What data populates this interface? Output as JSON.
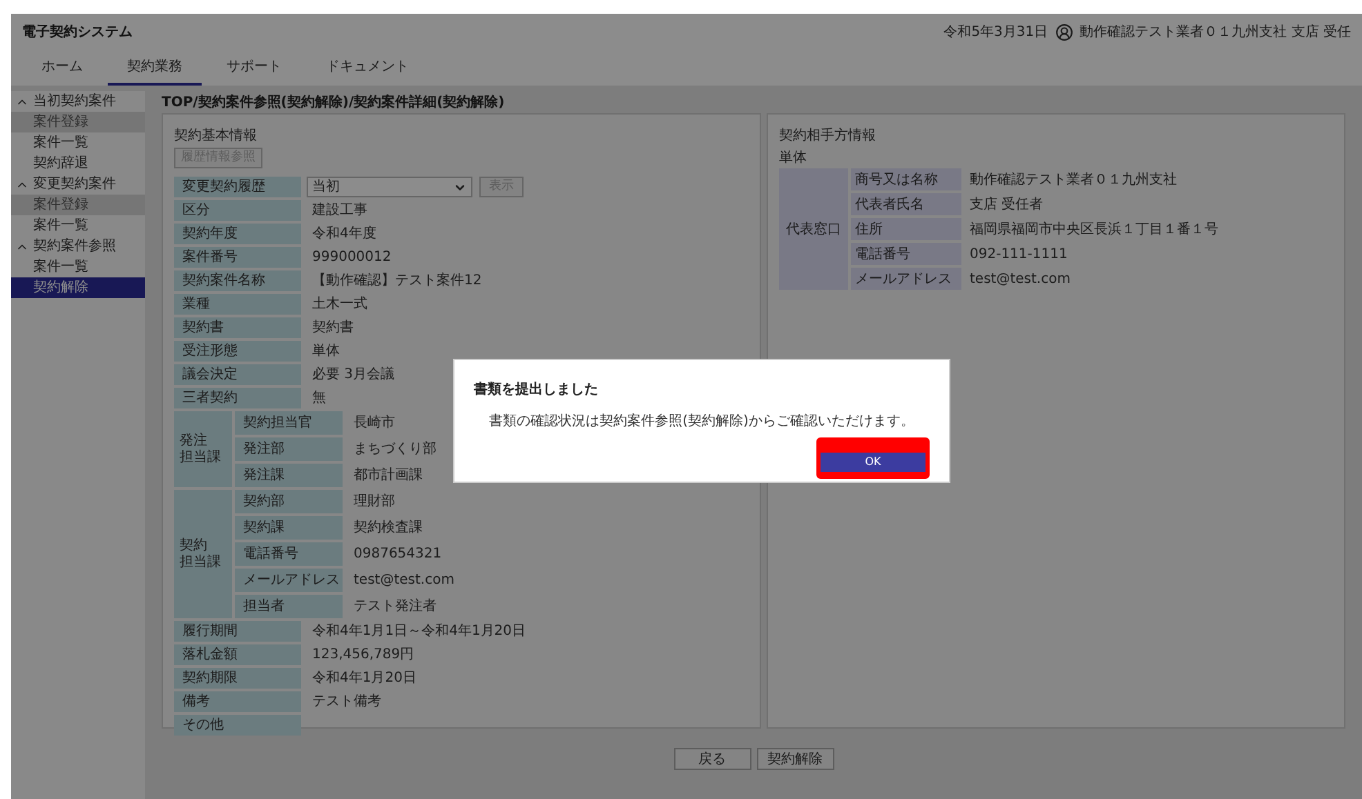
{
  "app": {
    "title": "電子契約システム",
    "date": "令和5年3月31日",
    "user": "動作確認テスト業者０１九州支社 支店 受任"
  },
  "tabs": [
    {
      "label": "ホーム",
      "selected": false
    },
    {
      "label": "契約業務",
      "selected": true
    },
    {
      "label": "サポート",
      "selected": false
    },
    {
      "label": "ドキュメント",
      "selected": false
    }
  ],
  "sidebar": [
    {
      "label": "当初契約案件",
      "expanded": true,
      "children": [
        {
          "label": "案件登録",
          "disabled": true,
          "selected": false
        },
        {
          "label": "案件一覧",
          "disabled": false,
          "selected": false
        },
        {
          "label": "契約辞退",
          "disabled": false,
          "selected": false
        }
      ]
    },
    {
      "label": "変更契約案件",
      "expanded": true,
      "children": [
        {
          "label": "案件登録",
          "disabled": true,
          "selected": false
        },
        {
          "label": "案件一覧",
          "disabled": false,
          "selected": false
        }
      ]
    },
    {
      "label": "契約案件参照",
      "expanded": true,
      "children": [
        {
          "label": "案件一覧",
          "disabled": false,
          "selected": false
        },
        {
          "label": "契約解除",
          "disabled": false,
          "selected": true
        }
      ]
    }
  ],
  "breadcrumb": "TOP/契約案件参照(契約解除)/契約案件詳細(契約解除)",
  "contract": {
    "title": "契約基本情報",
    "history_button": {
      "label": "履歴情報参照",
      "disabled": true
    },
    "rows": [
      {
        "kind": "select",
        "label": "変更契約履歴",
        "value": "当初",
        "button": "表示",
        "button_disabled": true
      },
      {
        "kind": "field",
        "label": "区分",
        "value": "建設工事"
      },
      {
        "kind": "field",
        "label": "契約年度",
        "value": "令和4年度"
      },
      {
        "kind": "field",
        "label": "案件番号",
        "value": "999000012"
      },
      {
        "kind": "field",
        "label": "契約案件名称",
        "value": "【動作確認】テスト案件12"
      },
      {
        "kind": "field",
        "label": "業種",
        "value": "土木一式"
      },
      {
        "kind": "field",
        "label": "契約書",
        "value": "契約書"
      },
      {
        "kind": "field",
        "label": "受注形態",
        "value": "単体"
      },
      {
        "kind": "field",
        "label": "議会決定",
        "value": "必要 3月会議"
      },
      {
        "kind": "field",
        "label": "三者契約",
        "value": "無"
      },
      {
        "kind": "group",
        "label_lines": [
          "発注",
          "担当課"
        ],
        "items": [
          {
            "label": "契約担当官",
            "value": "長崎市"
          },
          {
            "label": "発注部",
            "value": "まちづくり部"
          },
          {
            "label": "発注課",
            "value": "都市計画課"
          }
        ]
      },
      {
        "kind": "group",
        "label_lines": [
          "契約",
          "担当課"
        ],
        "items": [
          {
            "label": "契約部",
            "value": "理財部"
          },
          {
            "label": "契約課",
            "value": "契約検査課"
          },
          {
            "label": "電話番号",
            "value": "0987654321"
          },
          {
            "label": "メールアドレス",
            "value": "test@test.com"
          },
          {
            "label": "担当者",
            "value": "テスト発注者"
          }
        ]
      },
      {
        "kind": "field",
        "label": "履行期間",
        "value": "令和4年1月1日～令和4年1月20日"
      },
      {
        "kind": "field",
        "label": "落札金額",
        "value": "123,456,789円"
      },
      {
        "kind": "field",
        "label": "契約期限",
        "value": "令和4年1月20日"
      },
      {
        "kind": "field",
        "label": "備考",
        "value": "テスト備考"
      },
      {
        "kind": "field",
        "label": "その他"
      }
    ]
  },
  "partner": {
    "title": "契約相手方情報",
    "type": "単体",
    "group": "代表窓口",
    "items": [
      {
        "label": "商号又は名称",
        "value": "動作確認テスト業者０１九州支社"
      },
      {
        "label": "代表者氏名",
        "value": "支店 受任者"
      },
      {
        "label": "住所",
        "value": "福岡県福岡市中央区長浜１丁目１番１号"
      },
      {
        "label": "電話番号",
        "value": "092-111-1111"
      },
      {
        "label": "メールアドレス",
        "value": "test@test.com"
      }
    ]
  },
  "footer_buttons": [
    {
      "label": "戻る"
    },
    {
      "label": "契約解除"
    }
  ],
  "dialog": {
    "title": "書類を提出しました",
    "message": "書類の確認状況は契約案件参照(契約解除)からご確認いただけます。",
    "ok": "OK",
    "highlighted": true
  }
}
